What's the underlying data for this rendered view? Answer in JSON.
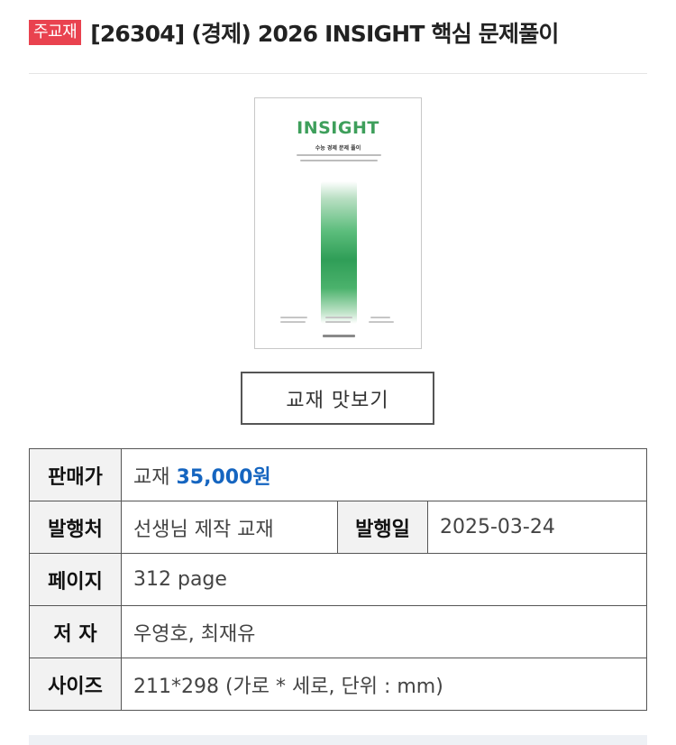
{
  "header": {
    "badge": "주교재",
    "title": "[26304] (경제) 2026 INSIGHT 핵심 문제풀이"
  },
  "cover": {
    "title": "INSIGHT",
    "subtitle": "수능 경제 문제 풀이"
  },
  "preview_button": "교재 맛보기",
  "info": {
    "price_label": "판매가",
    "price_prefix": "교재",
    "price": "35,000원",
    "publisher_label": "발행처",
    "publisher": "선생님 제작 교재",
    "date_label": "발행일",
    "date": "2025-03-24",
    "pages_label": "페이지",
    "pages": "312 page",
    "author_label": "저 자",
    "author": "우영호, 최재유",
    "size_label": "사이즈",
    "size": "211*298 (가로 * 세로, 단위 : mm)"
  },
  "colors": {
    "badge": "#e9424f",
    "price": "#1565c0",
    "cover_accent": "#3e9f5b"
  }
}
